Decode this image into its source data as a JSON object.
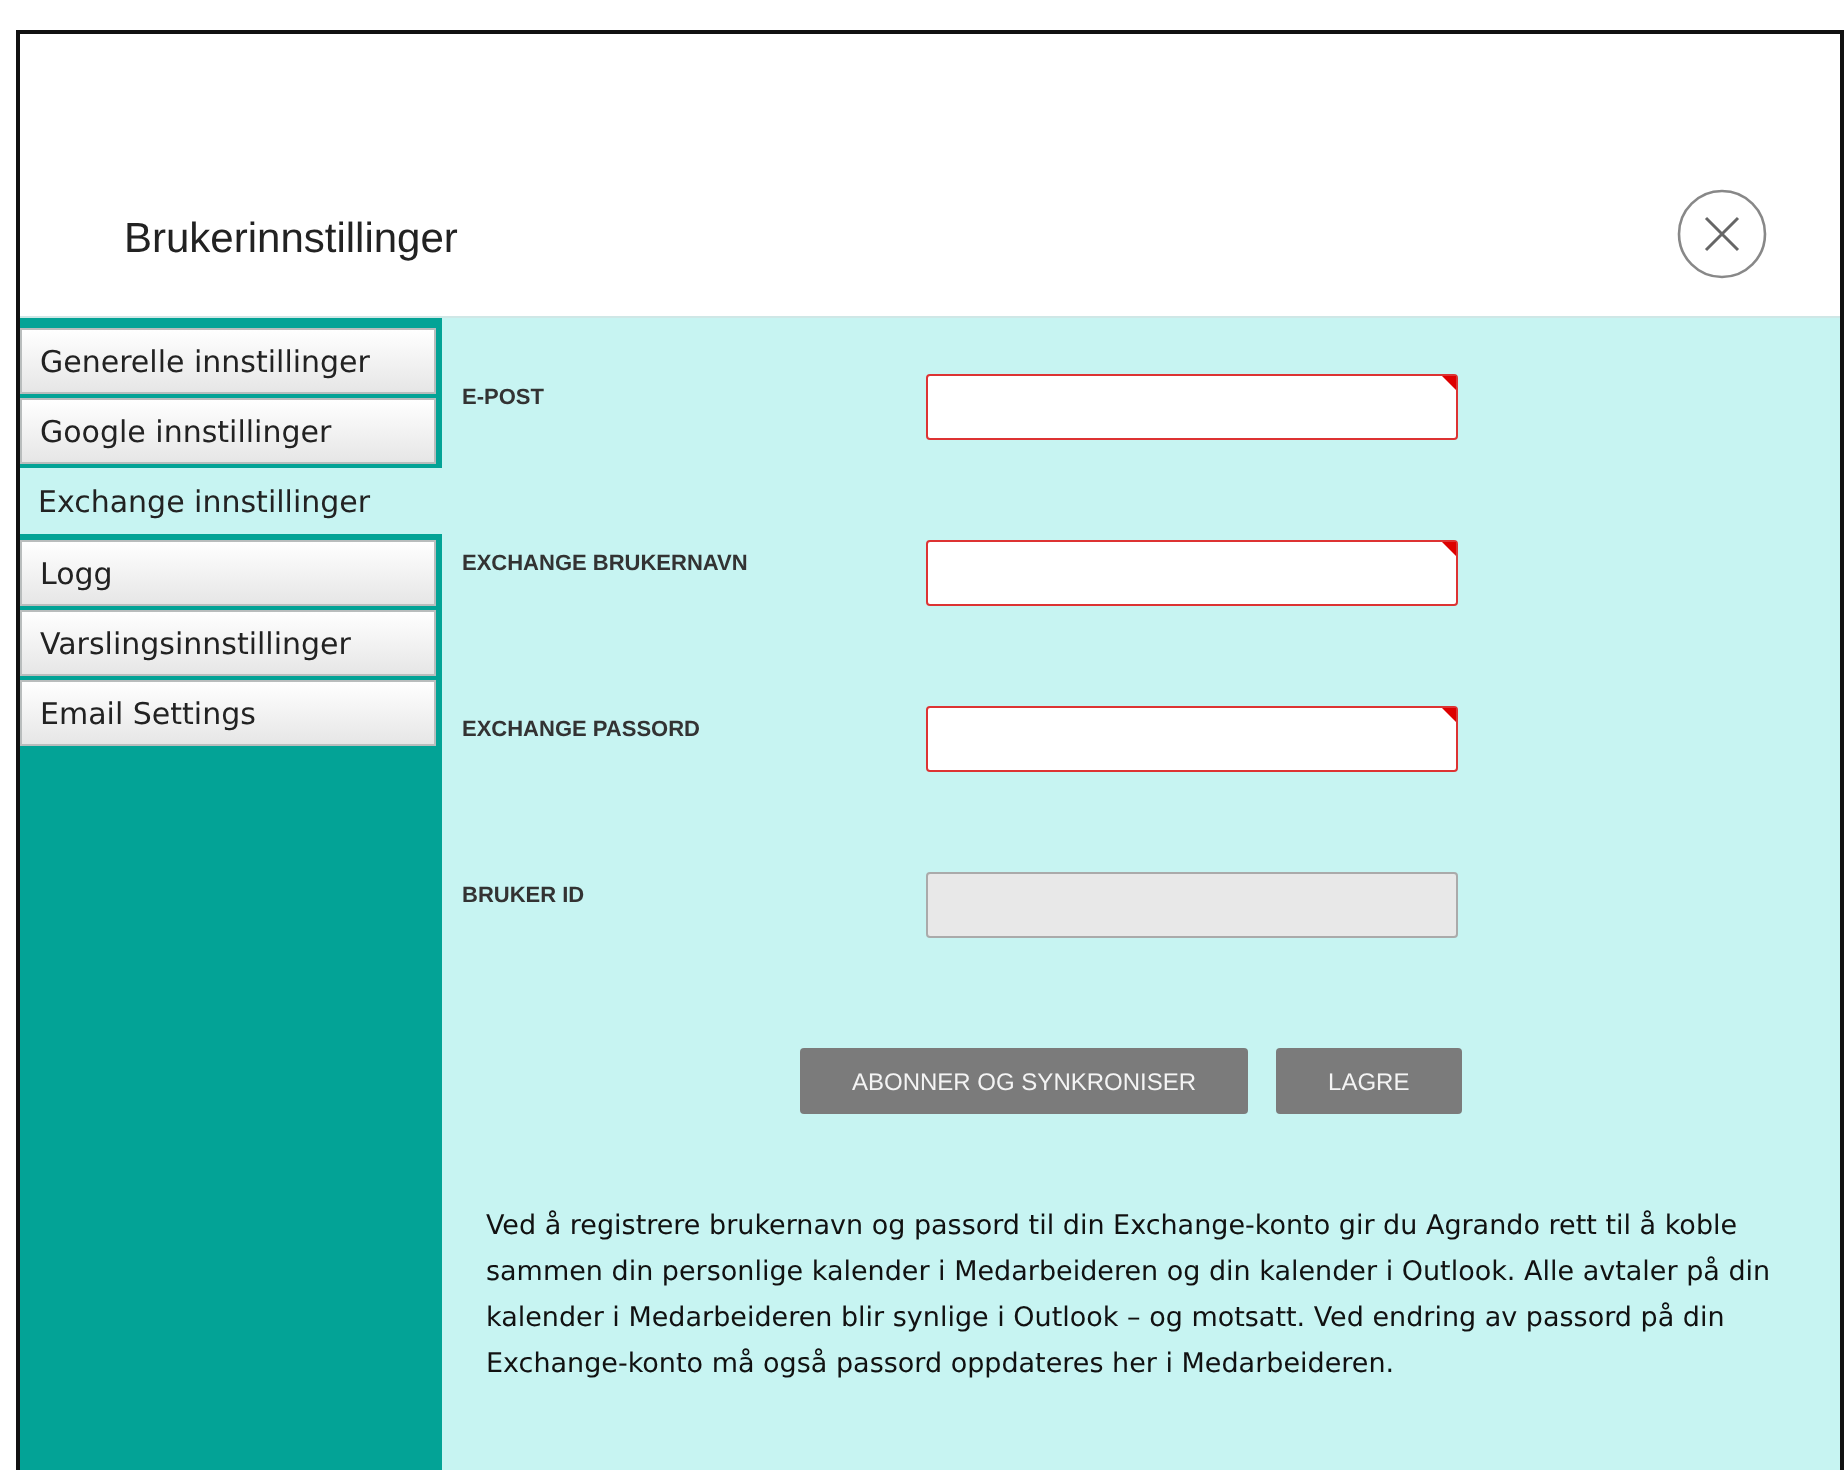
{
  "dialog": {
    "title": "Brukerinnstillinger"
  },
  "tabs": [
    {
      "label": "Generelle innstillinger",
      "selected": false
    },
    {
      "label": "Google innstillinger",
      "selected": false
    },
    {
      "label": "Exchange innstillinger",
      "selected": true
    },
    {
      "label": "Logg",
      "selected": false
    },
    {
      "label": "Varslingsinnstillinger",
      "selected": false
    },
    {
      "label": "Email Settings",
      "selected": false
    }
  ],
  "fields": [
    {
      "label": "E-POST",
      "kind": "required"
    },
    {
      "label": "EXCHANGE BRUKERNAVN",
      "kind": "required"
    },
    {
      "label": "EXCHANGE PASSORD",
      "kind": "required"
    },
    {
      "label": "BRUKER ID",
      "kind": "readonly"
    }
  ],
  "buttons": [
    "ABONNER OG SYNKRONISER",
    "LAGRE"
  ],
  "info_text": "Ved å registrere brukernavn og passord til din Exchange-konto gir du Agrando rett til å koble sammen din personlige kalender i Medarbeideren og din kalender i Outlook. Alle avtaler på din kalender i Medarbeideren blir synlige i Outlook – og motsatt. Ved endring av passord på din Exchange-konto må også passord oppdateres her i Medarbeideren."
}
